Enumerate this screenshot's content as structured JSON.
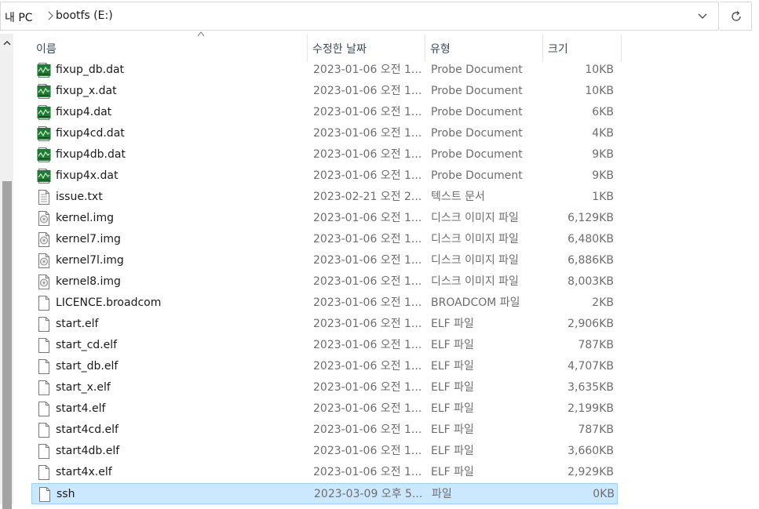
{
  "address": {
    "crumbs": [
      "내 PC",
      "bootfs (E:)"
    ]
  },
  "columns": {
    "name": "이름",
    "date": "수정한 날짜",
    "type": "유형",
    "size": "크기"
  },
  "files": [
    {
      "name": "fixup_db.dat",
      "date": "2023-01-06 오전 1...",
      "type": "Probe Document",
      "size": "10KB",
      "icon": "probe-document-icon"
    },
    {
      "name": "fixup_x.dat",
      "date": "2023-01-06 오전 1...",
      "type": "Probe Document",
      "size": "10KB",
      "icon": "probe-document-icon"
    },
    {
      "name": "fixup4.dat",
      "date": "2023-01-06 오전 1...",
      "type": "Probe Document",
      "size": "6KB",
      "icon": "probe-document-icon"
    },
    {
      "name": "fixup4cd.dat",
      "date": "2023-01-06 오전 1...",
      "type": "Probe Document",
      "size": "4KB",
      "icon": "probe-document-icon"
    },
    {
      "name": "fixup4db.dat",
      "date": "2023-01-06 오전 1...",
      "type": "Probe Document",
      "size": "9KB",
      "icon": "probe-document-icon"
    },
    {
      "name": "fixup4x.dat",
      "date": "2023-01-06 오전 1...",
      "type": "Probe Document",
      "size": "9KB",
      "icon": "probe-document-icon"
    },
    {
      "name": "issue.txt",
      "date": "2023-02-21 오전 2...",
      "type": "텍스트 문서",
      "size": "1KB",
      "icon": "text-file-icon"
    },
    {
      "name": "kernel.img",
      "date": "2023-01-06 오전 1...",
      "type": "디스크 이미지 파일",
      "size": "6,129KB",
      "icon": "disk-image-icon"
    },
    {
      "name": "kernel7.img",
      "date": "2023-01-06 오전 1...",
      "type": "디스크 이미지 파일",
      "size": "6,480KB",
      "icon": "disk-image-icon"
    },
    {
      "name": "kernel7l.img",
      "date": "2023-01-06 오전 1...",
      "type": "디스크 이미지 파일",
      "size": "6,886KB",
      "icon": "disk-image-icon"
    },
    {
      "name": "kernel8.img",
      "date": "2023-01-06 오전 1...",
      "type": "디스크 이미지 파일",
      "size": "8,003KB",
      "icon": "disk-image-icon"
    },
    {
      "name": "LICENCE.broadcom",
      "date": "2023-01-06 오전 1...",
      "type": "BROADCOM 파일",
      "size": "2KB",
      "icon": "blank-file-icon"
    },
    {
      "name": "start.elf",
      "date": "2023-01-06 오전 1...",
      "type": "ELF 파일",
      "size": "2,906KB",
      "icon": "blank-file-icon"
    },
    {
      "name": "start_cd.elf",
      "date": "2023-01-06 오전 1...",
      "type": "ELF 파일",
      "size": "787KB",
      "icon": "blank-file-icon"
    },
    {
      "name": "start_db.elf",
      "date": "2023-01-06 오전 1...",
      "type": "ELF 파일",
      "size": "4,707KB",
      "icon": "blank-file-icon"
    },
    {
      "name": "start_x.elf",
      "date": "2023-01-06 오전 1...",
      "type": "ELF 파일",
      "size": "3,635KB",
      "icon": "blank-file-icon"
    },
    {
      "name": "start4.elf",
      "date": "2023-01-06 오전 1...",
      "type": "ELF 파일",
      "size": "2,199KB",
      "icon": "blank-file-icon"
    },
    {
      "name": "start4cd.elf",
      "date": "2023-01-06 오전 1...",
      "type": "ELF 파일",
      "size": "787KB",
      "icon": "blank-file-icon"
    },
    {
      "name": "start4db.elf",
      "date": "2023-01-06 오전 1...",
      "type": "ELF 파일",
      "size": "3,660KB",
      "icon": "blank-file-icon"
    },
    {
      "name": "start4x.elf",
      "date": "2023-01-06 오전 1...",
      "type": "ELF 파일",
      "size": "2,929KB",
      "icon": "blank-file-icon"
    },
    {
      "name": "ssh",
      "date": "2023-03-09 오후 5...",
      "type": "파일",
      "size": "0KB",
      "icon": "blank-file-icon",
      "selected": true
    }
  ],
  "colors": {
    "selection_bg": "#cce8ff",
    "selection_border": "#99d1ff",
    "probe_icon": "#1e7a34"
  }
}
